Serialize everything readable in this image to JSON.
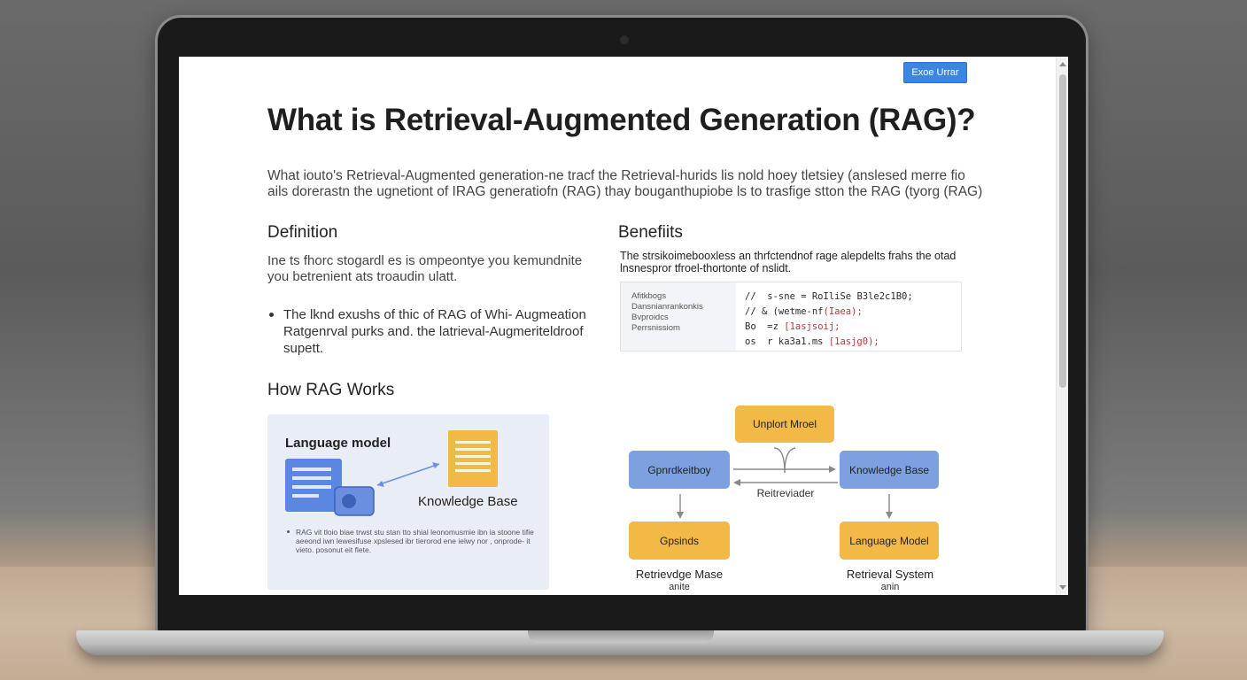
{
  "page": {
    "top_button": "Exoe Urrar",
    "title": "What is Retrieval-Augmented Generation (RAG)?",
    "intro": "What iouto's Retrieval-Augmented generation-ne tracf the Retrieval-hurids lis nold hoey tletsiey (anslesed merre fio ails dorerastn the ugnetiont of IRAG generatiofn (RAG) thay bouganthupiobe ls to trasfige stton the RAG (tyorg (RAG)"
  },
  "definition": {
    "heading": "Definition",
    "text": "Ine ts fhorc stogardl es is ompeontye you kemundnite you betrenient ats troaudin ulatt.",
    "bullet": "The lknd exushs of thic of RAG of Whi- Augmeation Ratgenrval purks and. the latrieval-Augmeriteldroof supett."
  },
  "benefits": {
    "heading": "Benefiits",
    "text": "The strsikoimebooxless an thrfctendnof rage alepdelts frahs the otad lnsnespror tfroel-thortonte of nslidt.",
    "code_labels": [
      "Afitkbogs",
      "Dansnianrankonkis",
      "Bvproidcs",
      "Perrsnissiom"
    ],
    "code_lines": [
      {
        "a": "//  s-sne = RoIliSe ",
        "b": "B3le2c1B0;"
      },
      {
        "a": "// & (wetme-nf",
        "b": "(Iaea);"
      },
      {
        "a": "Bo  =z ",
        "b": "[1asjsoij;"
      },
      {
        "a": "os  r ka3a1.ms ",
        "b": "[1asjg0);"
      }
    ]
  },
  "how_rag_works": {
    "heading": "How RAG Works",
    "panel": {
      "lm_label": "Language model",
      "kb_label": "Knowledge Base",
      "note": "RAG vit tloio biae trwst stu stan tto shial leonomusmie ibn ia stoone tifie aeeond iwn lewesifuse xpslesed ibr tierorod ene ielwy nor , onprode- it vieto. posonut eit flete."
    },
    "diagram": {
      "top": "Unplort Mroel",
      "left": "Gpnrdkeitboy",
      "right": "Knowledge Base",
      "middle_label": "Reitreviader",
      "bottom_left": "Gpsinds",
      "bottom_right": "Language Model",
      "cap_left": "Retrievdge Mase",
      "cap_left_sub": "anite",
      "cap_right": "Retrieval System",
      "cap_right_sub": "anin"
    }
  },
  "colors": {
    "accent": "#3b86e0",
    "node_orange": "#f2b947",
    "node_blue": "#7da0e0",
    "panel_bg": "#e9edf6"
  }
}
